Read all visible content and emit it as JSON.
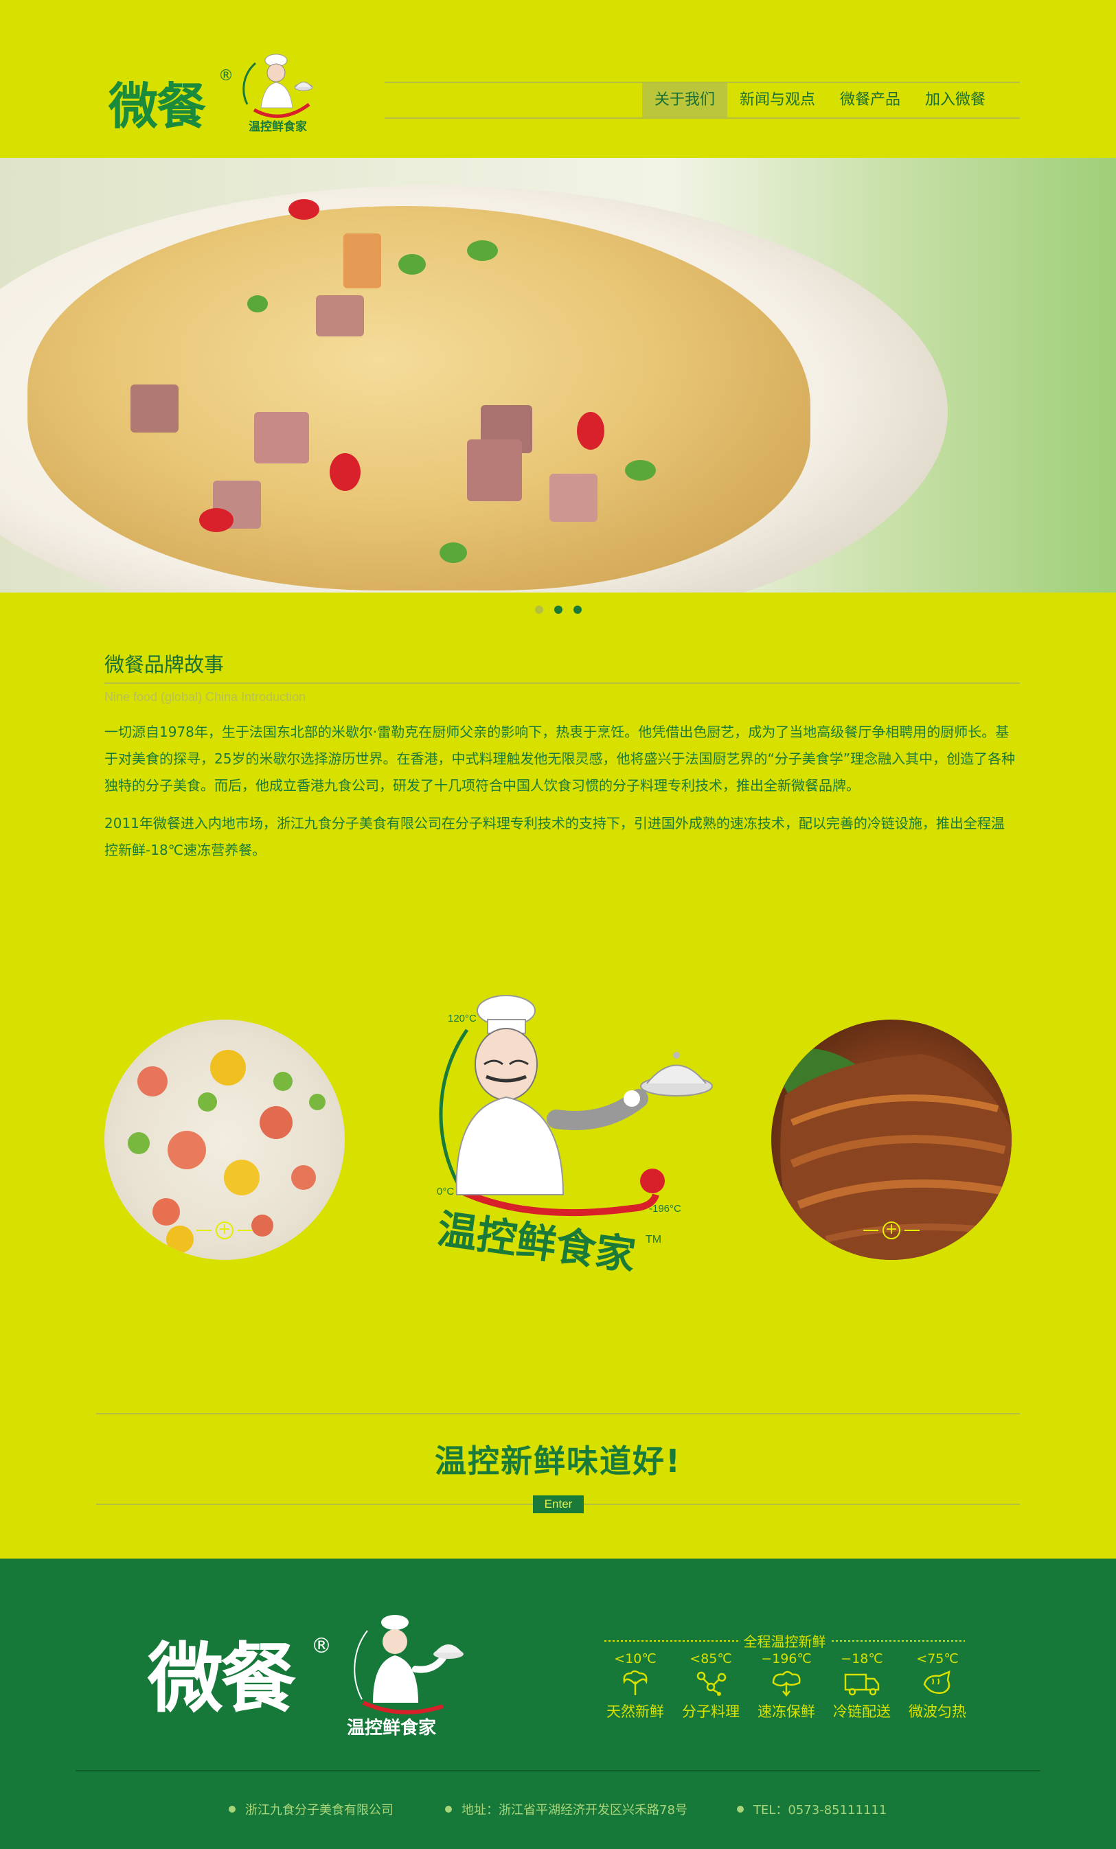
{
  "header": {
    "logo_text": "微餐",
    "logo_reg": "®",
    "chef_badge_text": "温控鲜食家",
    "nav": [
      {
        "label": "关于我们",
        "active": true
      },
      {
        "label": "新闻与观点",
        "active": false
      },
      {
        "label": "微餐产品",
        "active": false
      },
      {
        "label": "加入微餐",
        "active": false
      }
    ]
  },
  "hero": {
    "slide_count": 3,
    "active_slide": 2
  },
  "story": {
    "title": "微餐品牌故事",
    "subtitle": "Nine food (global) China Introduction",
    "paragraph1": "一切源自1978年，生于法国东北部的米歇尔·雷勒克在厨师父亲的影响下，热衷于烹饪。他凭借出色厨艺，成为了当地高级餐厅争相聘用的厨师长。基于对美食的探寻，25岁的米歇尔选择游历世界。在香港，中式料理触发他无限灵感，他将盛兴于法国厨艺界的“分子美食学”理念融入其中，创造了各种独特的分子美食。而后，他成立香港九食公司，研发了十几项符合中国人饮食习惯的分子料理专利技术，推出全新微餐品牌。",
    "paragraph2": "2011年微餐进入内地市场，浙江九食分子美食有限公司在分子料理专利技术的支持下，引进国外成熟的速冻技术，配以完善的冷链设施，推出全程温控新鲜-18℃速冻营养餐。"
  },
  "mascot": {
    "temp_top": "120°C",
    "temp_zero": "0°C",
    "temp_low": "-196°C",
    "brand": "温控鲜食家",
    "tm": "TM"
  },
  "slogan": {
    "text": "温控新鲜味道好!",
    "enter_label": "Enter"
  },
  "footer": {
    "logo_text": "微餐",
    "logo_reg": "®",
    "chef_badge_text": "温控鲜食家",
    "feature_title": "全程温控新鲜",
    "features": [
      {
        "temp": "<10℃",
        "label": "天然新鲜",
        "icon": "vegetable-icon"
      },
      {
        "temp": "<85℃",
        "label": "分子料理",
        "icon": "molecule-icon"
      },
      {
        "temp": "−196℃",
        "label": "速冻保鲜",
        "icon": "freeze-icon"
      },
      {
        "temp": "−18℃",
        "label": "冷链配送",
        "icon": "truck-icon"
      },
      {
        "temp": "<75℃",
        "label": "微波匀热",
        "icon": "microwave-icon"
      }
    ],
    "company": "浙江九食分子美食有限公司",
    "address": "地址：浙江省平湖经济开发区兴禾路78号",
    "tel": "TEL：0573-85111111"
  },
  "colors": {
    "background": "#d8e000",
    "brand_green": "#1a7a3a",
    "footer_green": "#16793a"
  }
}
